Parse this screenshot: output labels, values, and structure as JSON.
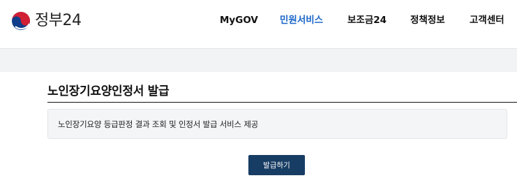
{
  "header": {
    "logo_text": "정부24",
    "nav": [
      {
        "label": "MyGOV",
        "active": false
      },
      {
        "label": "민원서비스",
        "active": true
      },
      {
        "label": "보조금24",
        "active": false
      },
      {
        "label": "정책정보",
        "active": false
      },
      {
        "label": "고객센터",
        "active": false
      }
    ],
    "active_color": "#1a66c9"
  },
  "main": {
    "title": "노인장기요양인정서 발급",
    "description": "노인장기요양 등급판정 결과 조회 및 인정서 발급 서비스 제공",
    "issue_button_label": "발급하기",
    "button_color": "#183d64"
  }
}
